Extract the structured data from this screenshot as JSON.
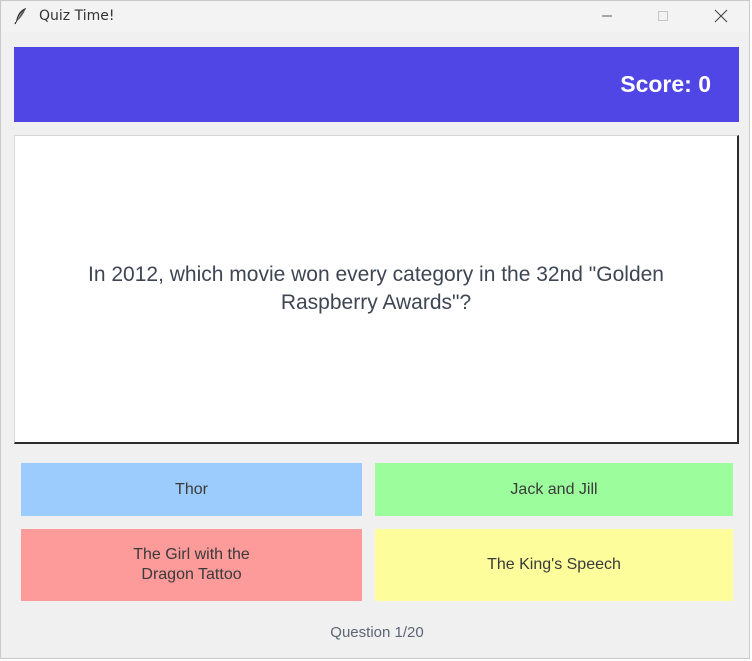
{
  "window": {
    "title": "Quiz Time!",
    "icon": "feather-icon"
  },
  "score": {
    "label": "Score: 0"
  },
  "question": {
    "text": "In 2012, which movie won every category in the 32nd \"Golden Raspberry Awards\"?"
  },
  "answers": [
    {
      "label": "Thor",
      "color": "#9ccbfd"
    },
    {
      "label": "Jack and Jill",
      "color": "#9cfd9c"
    },
    {
      "label": "The Girl with the Dragon Tattoo",
      "color": "#fd9a9a"
    },
    {
      "label": "The King's Speech",
      "color": "#fdfd9c"
    }
  ],
  "progress": {
    "label": "Question 1/20"
  },
  "colors": {
    "score_bar": "#5046e6",
    "question_text": "#3e4653"
  }
}
